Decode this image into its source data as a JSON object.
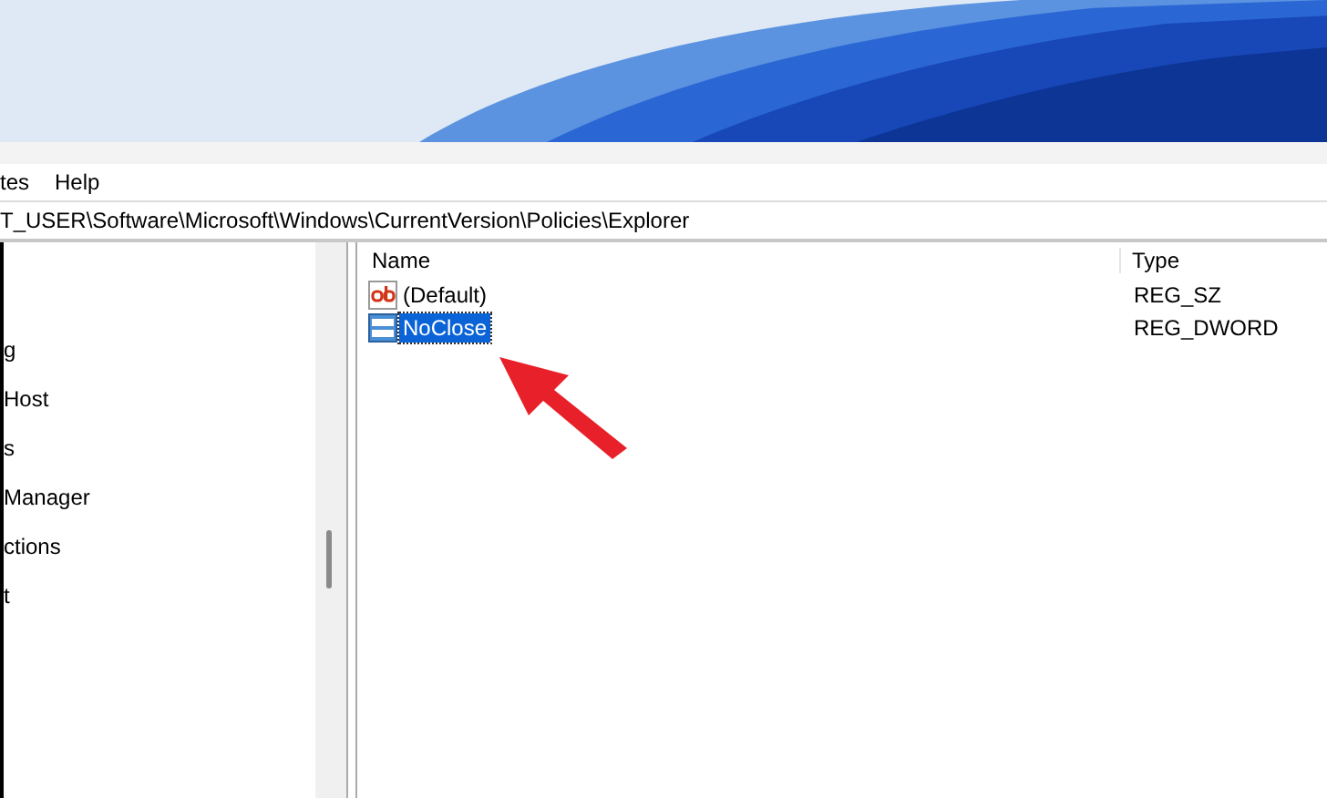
{
  "menu_bar": {
    "items": [
      "tes",
      "Help"
    ]
  },
  "address_bar": {
    "path": "T_USER\\Software\\Microsoft\\Windows\\CurrentVersion\\Policies\\Explorer"
  },
  "tree": {
    "items": [
      "g",
      "Host",
      "s",
      "Manager",
      "ctions",
      "t"
    ]
  },
  "values_list": {
    "columns": [
      "Name",
      "Type"
    ],
    "rows": [
      {
        "name": "(Default)",
        "type": "REG_SZ",
        "kind": "string",
        "selected": false
      },
      {
        "name": "NoClose",
        "type": "REG_DWORD",
        "kind": "binary",
        "selected": true
      }
    ]
  }
}
